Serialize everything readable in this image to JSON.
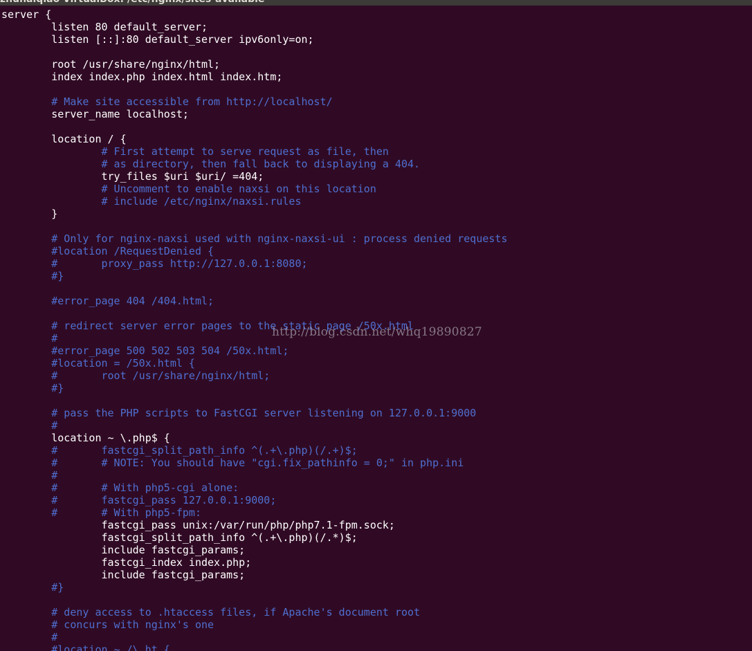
{
  "window": {
    "title": "zhuhaiqiao-VirtualBox: /etc/nginx/sites-available"
  },
  "colors": {
    "background": "#300a24",
    "code": "#ffffff",
    "comment": "#4f6fd0"
  },
  "watermark": "http://blog.csdn.net/whq19890827",
  "lines": [
    {
      "t": "server {",
      "c": 0
    },
    {
      "t": "        listen 80 default_server;",
      "c": 0
    },
    {
      "t": "        listen [::]:80 default_server ipv6only=on;",
      "c": 0
    },
    {
      "t": "",
      "c": 0
    },
    {
      "t": "        root /usr/share/nginx/html;",
      "c": 0
    },
    {
      "t": "        index index.php index.html index.htm;",
      "c": 0
    },
    {
      "t": "",
      "c": 0
    },
    {
      "t": "        # Make site accessible from http://localhost/",
      "c": 1
    },
    {
      "t": "        server_name localhost;",
      "c": 0
    },
    {
      "t": "",
      "c": 0
    },
    {
      "t": "        location / {",
      "c": 0
    },
    {
      "t": "                # First attempt to serve request as file, then",
      "c": 1
    },
    {
      "t": "                # as directory, then fall back to displaying a 404.",
      "c": 1
    },
    {
      "t": "                try_files $uri $uri/ =404;",
      "c": 0
    },
    {
      "t": "                # Uncomment to enable naxsi on this location",
      "c": 1
    },
    {
      "t": "                # include /etc/nginx/naxsi.rules",
      "c": 1
    },
    {
      "t": "        }",
      "c": 0
    },
    {
      "t": "",
      "c": 0
    },
    {
      "t": "        # Only for nginx-naxsi used with nginx-naxsi-ui : process denied requests",
      "c": 1
    },
    {
      "t": "        #location /RequestDenied {",
      "c": 1
    },
    {
      "t": "        #       proxy_pass http://127.0.0.1:8080;",
      "c": 1
    },
    {
      "t": "        #}",
      "c": 1
    },
    {
      "t": "",
      "c": 0
    },
    {
      "t": "        #error_page 404 /404.html;",
      "c": 1
    },
    {
      "t": "",
      "c": 0
    },
    {
      "t": "        # redirect server error pages to the static page /50x.html",
      "c": 1
    },
    {
      "t": "        #",
      "c": 1
    },
    {
      "t": "        #error_page 500 502 503 504 /50x.html;",
      "c": 1
    },
    {
      "t": "        #location = /50x.html {",
      "c": 1
    },
    {
      "t": "        #       root /usr/share/nginx/html;",
      "c": 1
    },
    {
      "t": "        #}",
      "c": 1
    },
    {
      "t": "",
      "c": 0
    },
    {
      "t": "        # pass the PHP scripts to FastCGI server listening on 127.0.0.1:9000",
      "c": 1
    },
    {
      "t": "        #",
      "c": 1
    },
    {
      "t": "        location ~ \\.php$ {",
      "c": 0
    },
    {
      "t": "        #       fastcgi_split_path_info ^(.+\\.php)(/.+)$;",
      "c": 1
    },
    {
      "t": "        #       # NOTE: You should have \"cgi.fix_pathinfo = 0;\" in php.ini",
      "c": 1
    },
    {
      "t": "        #",
      "c": 1
    },
    {
      "t": "        #       # With php5-cgi alone:",
      "c": 1
    },
    {
      "t": "        #       fastcgi_pass 127.0.0.1:9000;",
      "c": 1
    },
    {
      "t": "        #       # With php5-fpm:",
      "c": 1
    },
    {
      "t": "                fastcgi_pass unix:/var/run/php/php7.1-fpm.sock;",
      "c": 0
    },
    {
      "t": "                fastcgi_split_path_info ^(.+\\.php)(/.*)$;",
      "c": 0
    },
    {
      "t": "                include fastcgi_params;",
      "c": 0
    },
    {
      "t": "                fastcgi_index index.php;",
      "c": 0
    },
    {
      "t": "                include fastcgi_params;",
      "c": 0
    },
    {
      "t": "        #}",
      "c": 1
    },
    {
      "t": "",
      "c": 0
    },
    {
      "t": "        # deny access to .htaccess files, if Apache's document root",
      "c": 1
    },
    {
      "t": "        # concurs with nginx's one",
      "c": 1
    },
    {
      "t": "        #",
      "c": 1
    },
    {
      "t": "        #location ~ /\\.ht {",
      "c": 1
    }
  ]
}
